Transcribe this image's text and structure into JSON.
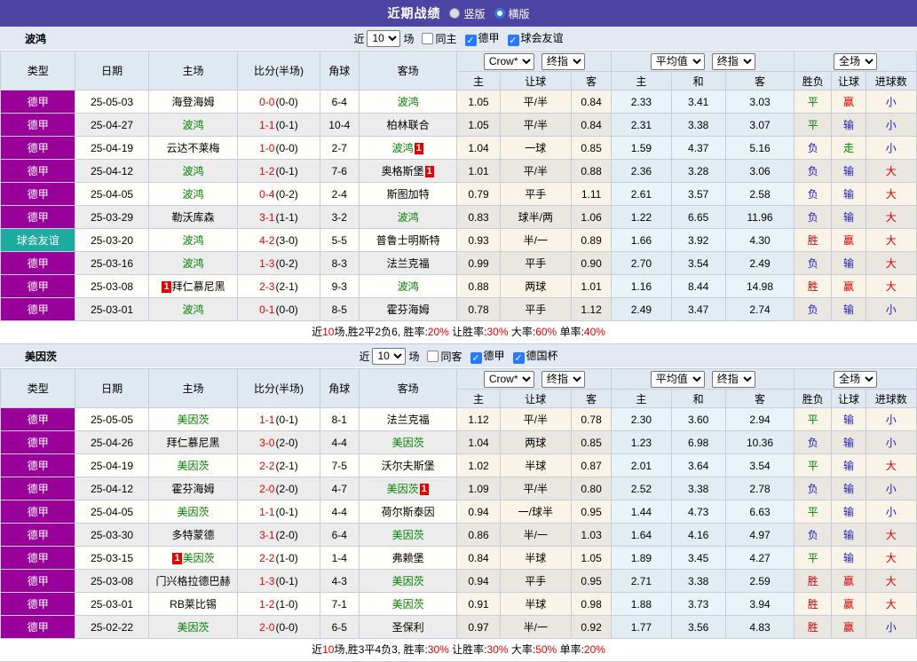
{
  "icons": {
    "checkmark": "✓",
    "dropdown_arrow": "▼"
  },
  "colors": {
    "topbar_purple": "#4c43a2",
    "league_cell_purple": "#990099",
    "friendly_cell_teal": "#1cab9f",
    "focus_team_green": "#008000",
    "score_red": "#e60000",
    "result_red": "#d40000",
    "result_blue": "#1c1cc4",
    "result_green": "#008000",
    "checkbox_blue": "#2979ff"
  },
  "header": {
    "title": "近期战绩",
    "radio_vertical": "竖版",
    "radio_horizontal": "横版",
    "vertical_checked": false,
    "horizontal_checked": true
  },
  "cols": {
    "main": [
      "类型",
      "日期",
      "主场",
      "比分(半场)",
      "角球",
      "客场"
    ],
    "sub": [
      "主",
      "让球",
      "客",
      "主",
      "和",
      "客",
      "胜负",
      "让球",
      "进球数"
    ]
  },
  "sections": [
    {
      "team": "波鸿",
      "filter": {
        "near": "近",
        "n": "10",
        "games": "场",
        "boxes": [
          {
            "label": "同主",
            "checked": false
          },
          {
            "label": "德甲",
            "checked": true
          },
          {
            "label": "球会友谊",
            "checked": true
          }
        ]
      },
      "dropdowns": [
        "Crow*",
        "终指",
        "平均值",
        "终指",
        "全场"
      ],
      "rows": [
        {
          "ty": "德甲",
          "tc": "lg",
          "d": "25-05-03",
          "h": "海登海姆",
          "hf": false,
          "hb": "",
          "hbp": "",
          "s": "0-0",
          "sh": "(0-0)",
          "c": "6-4",
          "a": "波鸿",
          "af": true,
          "ab": "",
          "abp": "",
          "o": [
            "1.05",
            "平/半",
            "0.84"
          ],
          "v": [
            "2.33",
            "3.41",
            "3.03"
          ],
          "r": [
            "平",
            "赢",
            "小"
          ]
        },
        {
          "ty": "德甲",
          "tc": "lg",
          "d": "25-04-27",
          "h": "波鸿",
          "hf": true,
          "hb": "",
          "hbp": "",
          "s": "1-1",
          "sh": "(0-1)",
          "c": "10-4",
          "a": "柏林联合",
          "af": false,
          "ab": "",
          "abp": "",
          "o": [
            "1.05",
            "平/半",
            "0.84"
          ],
          "v": [
            "2.31",
            "3.38",
            "3.07"
          ],
          "r": [
            "平",
            "输",
            "小"
          ]
        },
        {
          "ty": "德甲",
          "tc": "lg",
          "d": "25-04-19",
          "h": "云达不莱梅",
          "hf": false,
          "hb": "",
          "hbp": "",
          "s": "1-0",
          "sh": "(0-0)",
          "c": "2-7",
          "a": "波鸿",
          "af": true,
          "ab": "1",
          "abp": "R",
          "o": [
            "1.04",
            "一球",
            "0.85"
          ],
          "v": [
            "1.59",
            "4.37",
            "5.16"
          ],
          "r": [
            "负",
            "走",
            "小"
          ]
        },
        {
          "ty": "德甲",
          "tc": "lg",
          "d": "25-04-12",
          "h": "波鸿",
          "hf": true,
          "hb": "",
          "hbp": "",
          "s": "1-2",
          "sh": "(0-1)",
          "c": "7-6",
          "a": "奥格斯堡",
          "af": false,
          "ab": "1",
          "abp": "R",
          "o": [
            "1.01",
            "平/半",
            "0.88"
          ],
          "v": [
            "2.36",
            "3.28",
            "3.06"
          ],
          "r": [
            "负",
            "输",
            "大"
          ]
        },
        {
          "ty": "德甲",
          "tc": "lg",
          "d": "25-04-05",
          "h": "波鸿",
          "hf": true,
          "hb": "",
          "hbp": "",
          "s": "0-4",
          "sh": "(0-2)",
          "c": "2-4",
          "a": "斯图加特",
          "af": false,
          "ab": "",
          "abp": "",
          "o": [
            "0.79",
            "平手",
            "1.11"
          ],
          "v": [
            "2.61",
            "3.57",
            "2.58"
          ],
          "r": [
            "负",
            "输",
            "大"
          ]
        },
        {
          "ty": "德甲",
          "tc": "lg",
          "d": "25-03-29",
          "h": "勒沃库森",
          "hf": false,
          "hb": "",
          "hbp": "",
          "s": "3-1",
          "sh": "(1-1)",
          "c": "3-2",
          "a": "波鸿",
          "af": true,
          "ab": "",
          "abp": "",
          "o": [
            "0.83",
            "球半/两",
            "1.06"
          ],
          "v": [
            "1.22",
            "6.65",
            "11.96"
          ],
          "r": [
            "负",
            "输",
            "大"
          ]
        },
        {
          "ty": "球会友谊",
          "tc": "fr",
          "d": "25-03-20",
          "h": "波鸿",
          "hf": true,
          "hb": "",
          "hbp": "",
          "s": "4-2",
          "sh": "(3-0)",
          "c": "5-5",
          "a": "普鲁士明斯特",
          "af": false,
          "ab": "",
          "abp": "",
          "o": [
            "0.93",
            "半/一",
            "0.89"
          ],
          "v": [
            "1.66",
            "3.92",
            "4.30"
          ],
          "r": [
            "胜",
            "赢",
            "大"
          ]
        },
        {
          "ty": "德甲",
          "tc": "lg",
          "d": "25-03-16",
          "h": "波鸿",
          "hf": true,
          "hb": "",
          "hbp": "",
          "s": "1-3",
          "sh": "(0-2)",
          "c": "8-3",
          "a": "法兰克福",
          "af": false,
          "ab": "",
          "abp": "",
          "o": [
            "0.99",
            "平手",
            "0.90"
          ],
          "v": [
            "2.70",
            "3.54",
            "2.49"
          ],
          "r": [
            "负",
            "输",
            "大"
          ]
        },
        {
          "ty": "德甲",
          "tc": "lg",
          "d": "25-03-08",
          "h": "拜仁慕尼黑",
          "hf": false,
          "hb": "1",
          "hbp": "L",
          "s": "2-3",
          "sh": "(2-1)",
          "c": "9-3",
          "a": "波鸿",
          "af": true,
          "ab": "",
          "abp": "",
          "o": [
            "0.88",
            "两球",
            "1.01"
          ],
          "v": [
            "1.16",
            "8.44",
            "14.98"
          ],
          "r": [
            "胜",
            "赢",
            "大"
          ]
        },
        {
          "ty": "德甲",
          "tc": "lg",
          "d": "25-03-01",
          "h": "波鸿",
          "hf": true,
          "hb": "",
          "hbp": "",
          "s": "0-1",
          "sh": "(0-0)",
          "c": "8-5",
          "a": "霍芬海姆",
          "af": false,
          "ab": "",
          "abp": "",
          "o": [
            "0.78",
            "平手",
            "1.12"
          ],
          "v": [
            "2.49",
            "3.47",
            "2.74"
          ],
          "r": [
            "负",
            "输",
            "小"
          ]
        }
      ],
      "summary": [
        {
          "t": "近",
          "red": false
        },
        {
          "t": "10",
          "red": true
        },
        {
          "t": "场,胜2平2负6, 胜率:",
          "red": false
        },
        {
          "t": "20%",
          "red": true
        },
        {
          "t": " 让胜率:",
          "red": false
        },
        {
          "t": "30%",
          "red": true
        },
        {
          "t": " 大率:",
          "red": false
        },
        {
          "t": "60%",
          "red": true
        },
        {
          "t": " 单率:",
          "red": false
        },
        {
          "t": "40%",
          "red": true
        }
      ]
    },
    {
      "team": "美因茨",
      "filter": {
        "near": "近",
        "n": "10",
        "games": "场",
        "boxes": [
          {
            "label": "同客",
            "checked": false
          },
          {
            "label": "德甲",
            "checked": true
          },
          {
            "label": "德国杯",
            "checked": true
          }
        ]
      },
      "dropdowns": [
        "Crow*",
        "终指",
        "平均值",
        "终指",
        "全场"
      ],
      "rows": [
        {
          "ty": "德甲",
          "tc": "lg",
          "d": "25-05-05",
          "h": "美因茨",
          "hf": true,
          "hb": "",
          "hbp": "",
          "s": "1-1",
          "sh": "(0-1)",
          "c": "8-1",
          "a": "法兰克福",
          "af": false,
          "ab": "",
          "abp": "",
          "o": [
            "1.12",
            "平/半",
            "0.78"
          ],
          "v": [
            "2.30",
            "3.60",
            "2.94"
          ],
          "r": [
            "平",
            "输",
            "小"
          ]
        },
        {
          "ty": "德甲",
          "tc": "lg",
          "d": "25-04-26",
          "h": "拜仁慕尼黑",
          "hf": false,
          "hb": "",
          "hbp": "",
          "s": "3-0",
          "sh": "(2-0)",
          "c": "4-4",
          "a": "美因茨",
          "af": true,
          "ab": "",
          "abp": "",
          "o": [
            "1.04",
            "两球",
            "0.85"
          ],
          "v": [
            "1.23",
            "6.98",
            "10.36"
          ],
          "r": [
            "负",
            "输",
            "小"
          ]
        },
        {
          "ty": "德甲",
          "tc": "lg",
          "d": "25-04-19",
          "h": "美因茨",
          "hf": true,
          "hb": "",
          "hbp": "",
          "s": "2-2",
          "sh": "(2-1)",
          "c": "7-5",
          "a": "沃尔夫斯堡",
          "af": false,
          "ab": "",
          "abp": "",
          "o": [
            "1.02",
            "半球",
            "0.87"
          ],
          "v": [
            "2.01",
            "3.64",
            "3.54"
          ],
          "r": [
            "平",
            "输",
            "大"
          ]
        },
        {
          "ty": "德甲",
          "tc": "lg",
          "d": "25-04-12",
          "h": "霍芬海姆",
          "hf": false,
          "hb": "",
          "hbp": "",
          "s": "2-0",
          "sh": "(2-0)",
          "c": "4-7",
          "a": "美因茨",
          "af": true,
          "ab": "1",
          "abp": "R",
          "o": [
            "1.09",
            "平/半",
            "0.80"
          ],
          "v": [
            "2.52",
            "3.38",
            "2.78"
          ],
          "r": [
            "负",
            "输",
            "小"
          ]
        },
        {
          "ty": "德甲",
          "tc": "lg",
          "d": "25-04-05",
          "h": "美因茨",
          "hf": true,
          "hb": "",
          "hbp": "",
          "s": "1-1",
          "sh": "(0-1)",
          "c": "4-4",
          "a": "荷尔斯泰因",
          "af": false,
          "ab": "",
          "abp": "",
          "o": [
            "0.94",
            "一/球半",
            "0.95"
          ],
          "v": [
            "1.44",
            "4.73",
            "6.63"
          ],
          "r": [
            "平",
            "输",
            "小"
          ]
        },
        {
          "ty": "德甲",
          "tc": "lg",
          "d": "25-03-30",
          "h": "多特蒙德",
          "hf": false,
          "hb": "",
          "hbp": "",
          "s": "3-1",
          "sh": "(2-0)",
          "c": "6-4",
          "a": "美因茨",
          "af": true,
          "ab": "",
          "abp": "",
          "o": [
            "0.86",
            "半/一",
            "1.03"
          ],
          "v": [
            "1.64",
            "4.16",
            "4.97"
          ],
          "r": [
            "负",
            "输",
            "大"
          ]
        },
        {
          "ty": "德甲",
          "tc": "lg",
          "d": "25-03-15",
          "h": "美因茨",
          "hf": true,
          "hb": "1",
          "hbp": "L",
          "s": "2-2",
          "sh": "(1-0)",
          "c": "1-4",
          "a": "弗赖堡",
          "af": false,
          "ab": "",
          "abp": "",
          "o": [
            "0.84",
            "半球",
            "1.05"
          ],
          "v": [
            "1.89",
            "3.45",
            "4.27"
          ],
          "r": [
            "平",
            "输",
            "大"
          ]
        },
        {
          "ty": "德甲",
          "tc": "lg",
          "d": "25-03-08",
          "h": "门兴格拉德巴赫",
          "hf": false,
          "hb": "",
          "hbp": "",
          "s": "1-3",
          "sh": "(0-1)",
          "c": "4-3",
          "a": "美因茨",
          "af": true,
          "ab": "",
          "abp": "",
          "o": [
            "0.94",
            "平手",
            "0.95"
          ],
          "v": [
            "2.71",
            "3.38",
            "2.59"
          ],
          "r": [
            "胜",
            "赢",
            "大"
          ]
        },
        {
          "ty": "德甲",
          "tc": "lg",
          "d": "25-03-01",
          "h": "RB莱比锡",
          "hf": false,
          "hb": "",
          "hbp": "",
          "s": "1-2",
          "sh": "(1-0)",
          "c": "7-1",
          "a": "美因茨",
          "af": true,
          "ab": "",
          "abp": "",
          "o": [
            "0.91",
            "半球",
            "0.98"
          ],
          "v": [
            "1.88",
            "3.73",
            "3.94"
          ],
          "r": [
            "胜",
            "赢",
            "大"
          ]
        },
        {
          "ty": "德甲",
          "tc": "lg",
          "d": "25-02-22",
          "h": "美因茨",
          "hf": true,
          "hb": "",
          "hbp": "",
          "s": "2-0",
          "sh": "(0-0)",
          "c": "6-5",
          "a": "圣保利",
          "af": false,
          "ab": "",
          "abp": "",
          "o": [
            "0.97",
            "半/一",
            "0.92"
          ],
          "v": [
            "1.77",
            "3.56",
            "4.83"
          ],
          "r": [
            "胜",
            "赢",
            "小"
          ]
        }
      ],
      "summary": [
        {
          "t": "近",
          "red": false
        },
        {
          "t": "10",
          "red": true
        },
        {
          "t": "场,胜3平4负3, 胜率:",
          "red": false
        },
        {
          "t": "30%",
          "red": true
        },
        {
          "t": " 让胜率:",
          "red": false
        },
        {
          "t": "30%",
          "red": true
        },
        {
          "t": " 大率:",
          "red": false
        },
        {
          "t": "50%",
          "red": true
        },
        {
          "t": " 单率:",
          "red": false
        },
        {
          "t": "20%",
          "red": true
        }
      ]
    }
  ]
}
